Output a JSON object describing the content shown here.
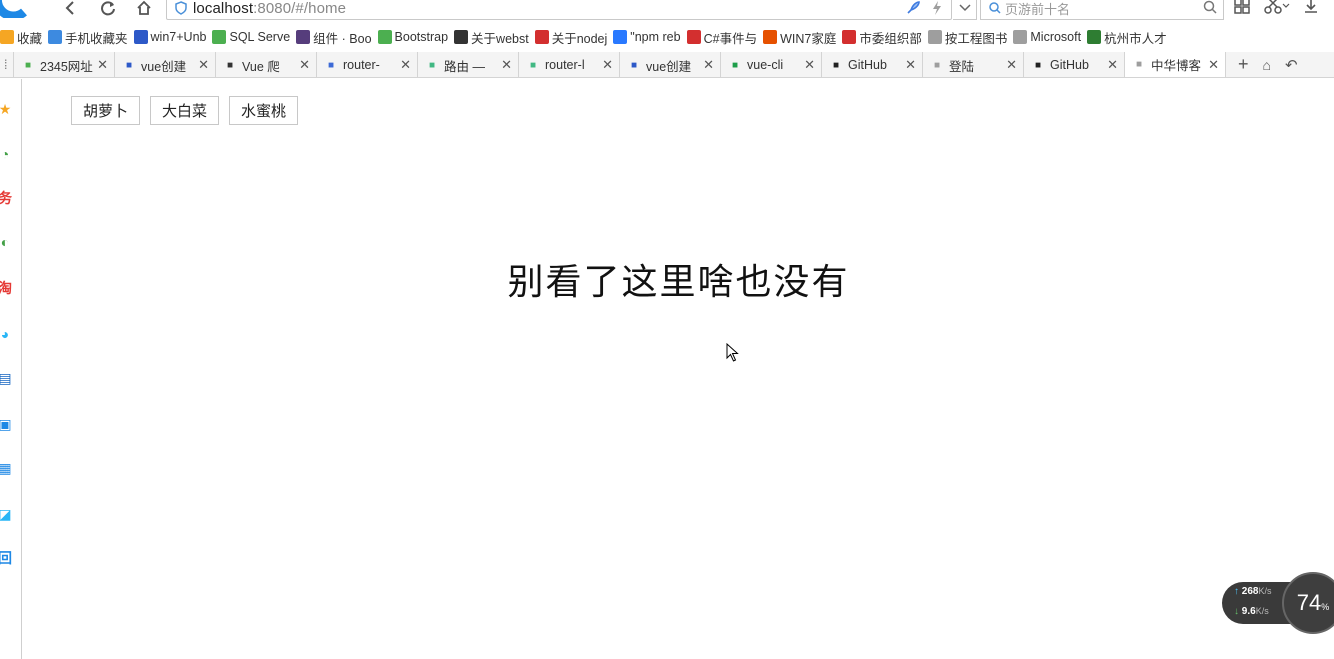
{
  "toolbar": {
    "url_host": "localhost",
    "url_rest": ":8080/#/home",
    "search_placeholder": "页游前十名"
  },
  "bookmarks": [
    {
      "label": "收藏",
      "icon": "star-icon",
      "color": "#f5a623"
    },
    {
      "label": "手机收藏夹",
      "icon": "phone-icon",
      "color": "#3d8ae0"
    },
    {
      "label": "win7+Unb",
      "icon": "paw-icon",
      "color": "#2d59c8"
    },
    {
      "label": "SQL Serve",
      "icon": "sql-icon",
      "color": "#4caf50"
    },
    {
      "label": "组件 · Boo",
      "icon": "bootstrap-icon",
      "color": "#563d7c"
    },
    {
      "label": "Bootstrap",
      "icon": "bootstrap-circle-icon",
      "color": "#4caf50"
    },
    {
      "label": "关于webst",
      "icon": "webstorm-icon",
      "color": "#333333"
    },
    {
      "label": "关于nodej",
      "icon": "cnblogs-icon",
      "color": "#d32f2f"
    },
    {
      "label": "\"npm reb",
      "icon": "npm-icon",
      "color": "#2979ff"
    },
    {
      "label": "C#事件与",
      "icon": "csdn-icon",
      "color": "#d32f2f"
    },
    {
      "label": "WIN7家庭",
      "icon": "windows-icon",
      "color": "#e65100"
    },
    {
      "label": "市委组织部",
      "icon": "party-icon",
      "color": "#d32f2f"
    },
    {
      "label": "按工程图书",
      "icon": "page-icon",
      "color": "#9e9e9e"
    },
    {
      "label": "Microsoft",
      "icon": "page-icon",
      "color": "#9e9e9e"
    },
    {
      "label": "杭州市人才",
      "icon": "tree-icon",
      "color": "#2e7d32"
    }
  ],
  "tabs": [
    {
      "label": "2345网址",
      "icon": "house-icon",
      "color": "#4caf50",
      "active": false
    },
    {
      "label": "vue创建",
      "icon": "paw-icon",
      "color": "#2d59c8",
      "active": false
    },
    {
      "label": "Vue 爬",
      "icon": "webstorm-icon",
      "color": "#333333",
      "active": false
    },
    {
      "label": "router-",
      "icon": "cluster-icon",
      "color": "#3d6ad6",
      "active": false
    },
    {
      "label": "路由 —",
      "icon": "vue-icon",
      "color": "#41b883",
      "active": false
    },
    {
      "label": "router-l",
      "icon": "vue-icon",
      "color": "#41b883",
      "active": false
    },
    {
      "label": "vue创建",
      "icon": "paw-icon",
      "color": "#2d59c8",
      "active": false
    },
    {
      "label": "vue-cli",
      "icon": "sf-icon",
      "color": "#1e9e4a",
      "active": false
    },
    {
      "label": "GitHub",
      "icon": "github-icon",
      "color": "#222222",
      "active": false
    },
    {
      "label": "登陆",
      "icon": "page-icon",
      "color": "#9e9e9e",
      "active": false
    },
    {
      "label": "GitHub",
      "icon": "github-icon",
      "color": "#222222",
      "active": false
    },
    {
      "label": "中华博客",
      "icon": "page-icon",
      "color": "#9e9e9e",
      "active": true
    }
  ],
  "sidebar": [
    {
      "icon": "star-icon",
      "glyph": "★",
      "color": "#f5a623"
    },
    {
      "icon": "clock-icon",
      "glyph": "◔",
      "color": "#43a047"
    },
    {
      "icon": "task-icon",
      "glyph": "务",
      "color": "#e53935"
    },
    {
      "icon": "chat-icon",
      "glyph": "◐",
      "color": "#43a047"
    },
    {
      "icon": "taobao-icon",
      "glyph": "淘",
      "color": "#e53935"
    },
    {
      "icon": "game-icon",
      "glyph": "◕",
      "color": "#29b6f6"
    },
    {
      "icon": "video-icon",
      "glyph": "▤",
      "color": "#1565c0"
    },
    {
      "icon": "computer-icon",
      "glyph": "▣",
      "color": "#1e88e5"
    },
    {
      "icon": "calculator-icon",
      "glyph": "▦",
      "color": "#1e88e5"
    },
    {
      "icon": "note-icon",
      "glyph": "◪",
      "color": "#29b6f6"
    },
    {
      "icon": "screenshot-icon",
      "glyph": "回",
      "color": "#1e88e5"
    }
  ],
  "nav_links": [
    "胡萝卜",
    "大白菜",
    "水蜜桃"
  ],
  "message": "别看了这里啥也没有",
  "speed": {
    "upload": "268",
    "upload_unit": "K/s",
    "download": "9.6",
    "download_unit": "K/s",
    "gauge_value": "74",
    "gauge_unit": "%"
  }
}
